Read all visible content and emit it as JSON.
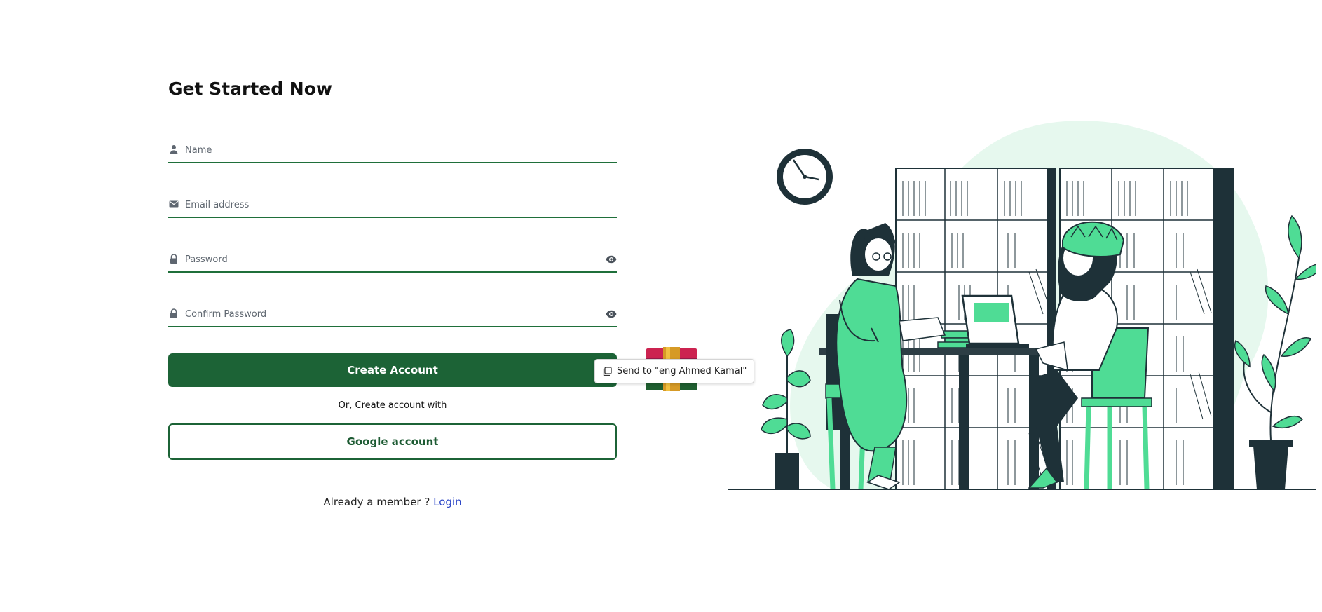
{
  "form": {
    "title": "Get Started Now",
    "fields": [
      {
        "placeholder": "Name",
        "icon": "user-icon"
      },
      {
        "placeholder": "Email address",
        "icon": "envelope-icon"
      },
      {
        "placeholder": "Password",
        "icon": "lock-icon",
        "toggle_icon": "eye-icon"
      },
      {
        "placeholder": "Confirm Password",
        "icon": "lock-icon",
        "toggle_icon": "eye-icon"
      }
    ],
    "create_button_label": "Create Account",
    "or_text": "Or, Create account with",
    "google_button_label": "Google account",
    "member_text": "Already a member ?",
    "login_link": "Login"
  },
  "tooltip": {
    "text": "Send to \"eng Ahmed Kamal\"",
    "icon": "copy-icon"
  },
  "colors": {
    "primary_green": "#1c6336",
    "accent_green": "#4fdc95",
    "dark_teal": "#1e3138",
    "link_blue": "#2d47c7"
  }
}
